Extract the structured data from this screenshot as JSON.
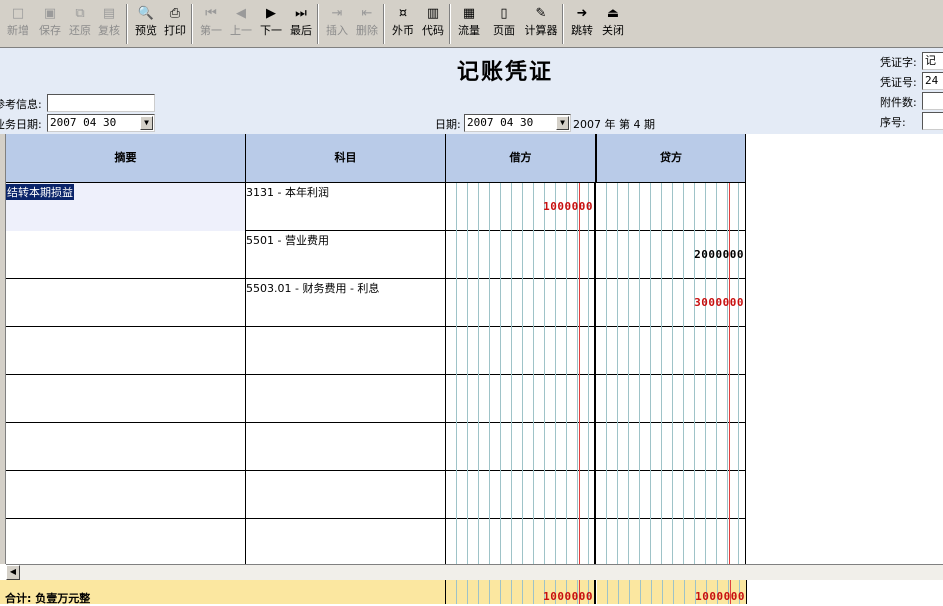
{
  "toolbar": {
    "buttons": [
      {
        "label": "新增",
        "icon": "□",
        "enabled": false
      },
      {
        "label": "保存",
        "icon": "▣",
        "enabled": false
      },
      {
        "label": "还原",
        "icon": "⧉",
        "enabled": false
      },
      {
        "label": "复核",
        "icon": "▤",
        "enabled": false
      },
      {
        "label": "预览",
        "icon": "🔍",
        "enabled": true
      },
      {
        "label": "打印",
        "icon": "⎙",
        "enabled": true
      },
      {
        "label": "第一",
        "icon": "⏮",
        "enabled": false
      },
      {
        "label": "上一",
        "icon": "◀",
        "enabled": false
      },
      {
        "label": "下一",
        "icon": "▶",
        "enabled": true
      },
      {
        "label": "最后",
        "icon": "⏭",
        "enabled": true
      },
      {
        "label": "插入",
        "icon": "⇥",
        "enabled": false
      },
      {
        "label": "删除",
        "icon": "⇤",
        "enabled": false
      },
      {
        "label": "外币",
        "icon": "¤",
        "enabled": true
      },
      {
        "label": "代码",
        "icon": "▥",
        "enabled": true
      },
      {
        "label": "流量",
        "icon": "▦",
        "enabled": true
      },
      {
        "label": "页面",
        "icon": "▯",
        "enabled": true
      },
      {
        "label": "计算器",
        "icon": "✎",
        "enabled": true
      },
      {
        "label": "跳转",
        "icon": "➜",
        "enabled": true
      },
      {
        "label": "关闭",
        "icon": "⏏",
        "enabled": true
      }
    ]
  },
  "header": {
    "title": "记账凭证",
    "ref_info_label": "参考信息:",
    "ref_info_value": "",
    "biz_date_label": "业务日期:",
    "biz_date_value": "2007 04 30",
    "date_label": "日期:",
    "date_value": "2007 04 30",
    "period_text": "2007 年 第 4 期",
    "voucher_word_label": "凭证字:",
    "voucher_word_value": "记",
    "voucher_no_label": "凭证号:",
    "voucher_no_value": "24",
    "attach_label": "附件数:",
    "attach_value": "",
    "seq_label": "序号:",
    "seq_value": ""
  },
  "grid": {
    "columns": [
      "摘要",
      "科目",
      "借方",
      "贷方"
    ],
    "rows": [
      {
        "summary": "结转本期损益",
        "account": "3131 - 本年利润",
        "debit": "1000000",
        "credit": "",
        "selected": true,
        "debit_color": "red",
        "credit_color": "black"
      },
      {
        "summary": "",
        "account": "5501 - 营业费用",
        "debit": "",
        "credit": "2000000",
        "selected": false,
        "debit_color": "black",
        "credit_color": "black"
      },
      {
        "summary": "",
        "account": "5503.01 - 财务费用 - 利息",
        "debit": "",
        "credit": "3000000",
        "selected": false,
        "debit_color": "black",
        "credit_color": "red"
      },
      {
        "summary": "",
        "account": "",
        "debit": "",
        "credit": ""
      },
      {
        "summary": "",
        "account": "",
        "debit": "",
        "credit": ""
      },
      {
        "summary": "",
        "account": "",
        "debit": "",
        "credit": ""
      },
      {
        "summary": "",
        "account": "",
        "debit": "",
        "credit": ""
      },
      {
        "summary": "",
        "account": "",
        "debit": "",
        "credit": ""
      }
    ]
  },
  "totals": {
    "label": "合计: 负壹万元整",
    "debit": "1000000",
    "credit": "1000000"
  },
  "colors": {
    "header_bg": "#e4ebf6",
    "column_header_bg": "#b9cbe8",
    "total_bg": "#fbe7a0",
    "amount_red": "#c81010"
  }
}
